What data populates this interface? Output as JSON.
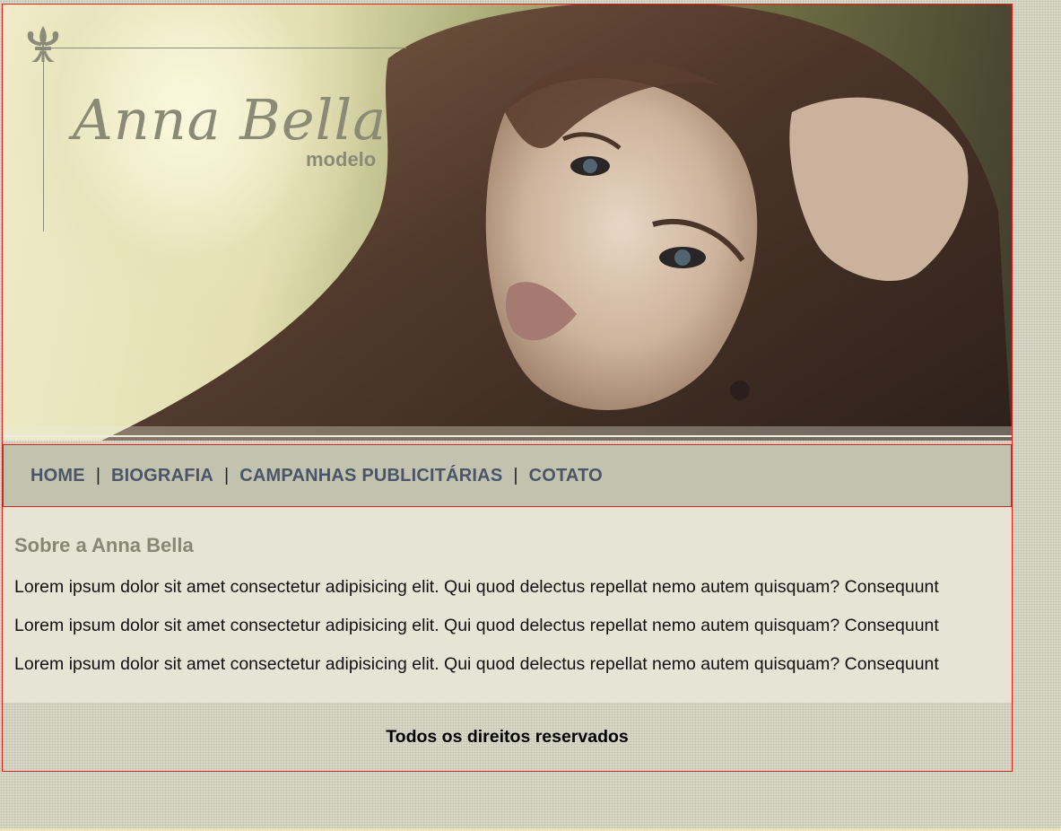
{
  "brand": {
    "name": "Anna Bella",
    "subtitle": "modelo"
  },
  "nav": {
    "items": [
      {
        "label": "HOME"
      },
      {
        "label": "BIOGRAFIA"
      },
      {
        "label": "CAMPANHAS PUBLICITÁRIAS"
      },
      {
        "label": "COTATO"
      }
    ],
    "separator": "|"
  },
  "main": {
    "heading": "Sobre a Anna Bella",
    "paragraphs": [
      "Lorem ipsum dolor sit amet consectetur adipisicing elit. Qui quod delectus repellat nemo autem quisquam? Consequunt",
      "Lorem ipsum dolor sit amet consectetur adipisicing elit. Qui quod delectus repellat nemo autem quisquam? Consequunt",
      "Lorem ipsum dolor sit amet consectetur adipisicing elit. Qui quod delectus repellat nemo autem quisquam? Consequunt"
    ]
  },
  "footer": {
    "text": "Todos os direitos reservados"
  },
  "icons": {
    "logo_ornament": "fleur-de-lis-icon"
  },
  "colors": {
    "nav_link": "#4b5468",
    "heading": "#878776",
    "border": "#e31c1c",
    "nav_bg": "#c2c3af",
    "content_bg": "#e6e5d5"
  }
}
